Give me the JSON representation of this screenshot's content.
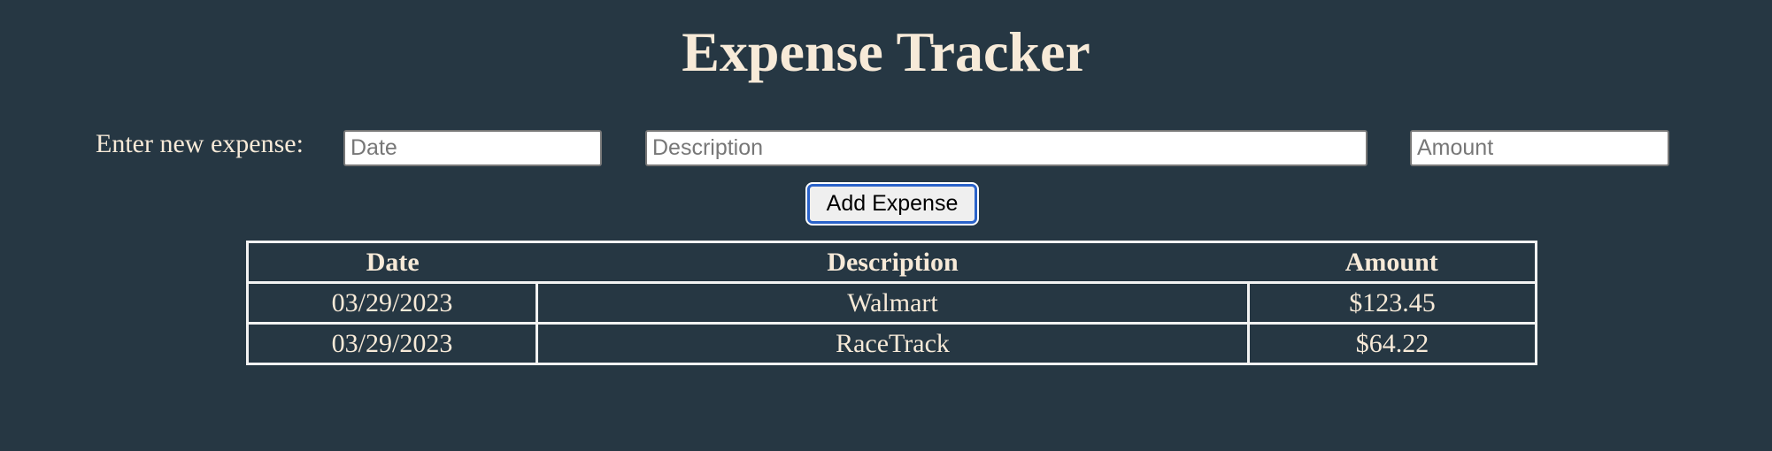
{
  "title": "Expense Tracker",
  "form": {
    "label": "Enter new expense:",
    "date_placeholder": "Date",
    "description_placeholder": "Description",
    "amount_placeholder": "Amount",
    "add_button": "Add Expense"
  },
  "table": {
    "headers": [
      "Date",
      "Description",
      "Amount"
    ],
    "rows": [
      [
        "03/29/2023",
        "Walmart",
        "$123.45"
      ],
      [
        "03/29/2023",
        "RaceTrack",
        "$64.22"
      ]
    ]
  }
}
